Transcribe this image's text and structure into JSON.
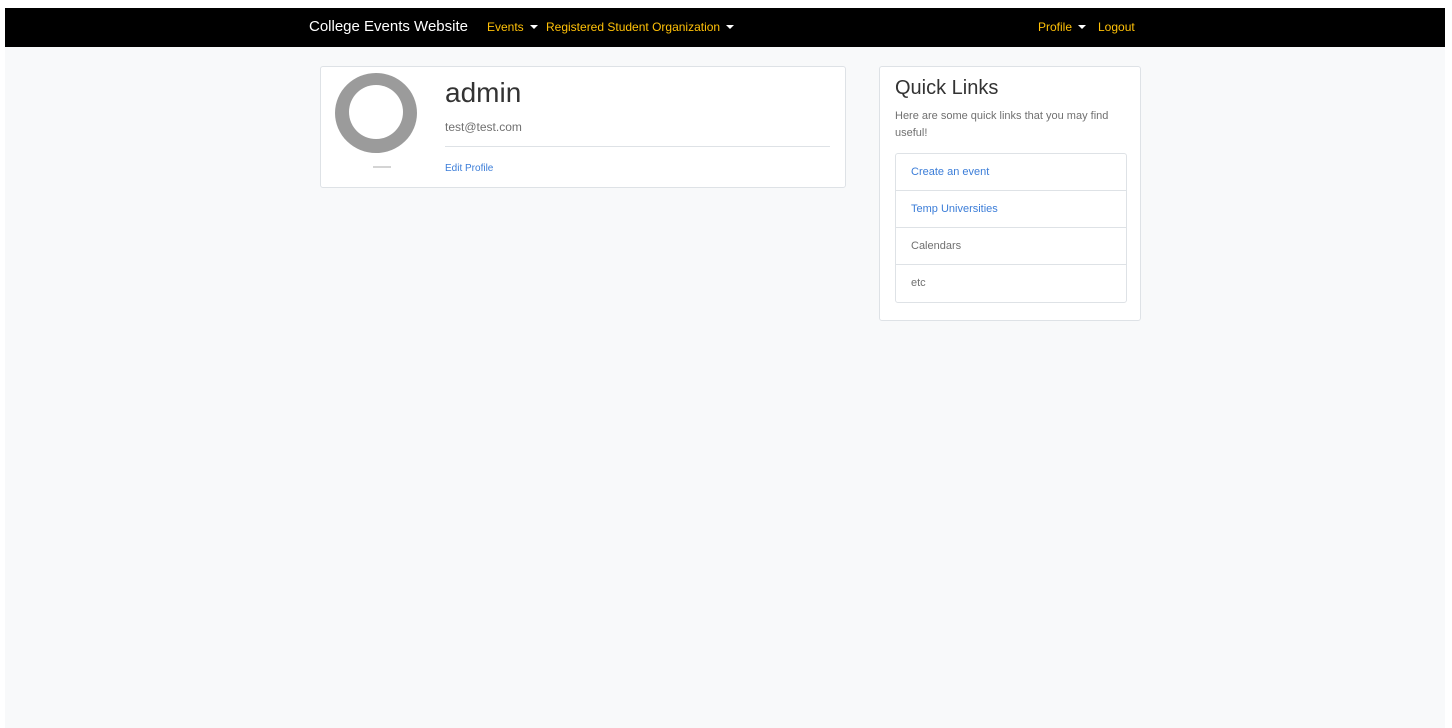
{
  "navbar": {
    "brand": "College Events Website",
    "events_label": "Events",
    "rso_label": "Registered Student Organization",
    "profile_label": "Profile",
    "logout_label": "Logout",
    "link_color": "#ffc107",
    "background_color": "#000000"
  },
  "profile": {
    "avatar_icon": "user-silhouette-icon",
    "username": "admin",
    "email": "test@test.com",
    "edit_link": "Edit Profile"
  },
  "quick_links": {
    "title": "Quick Links",
    "description": "Here are some quick links that you may find useful!",
    "items": [
      {
        "label": "Create an event",
        "is_link": true
      },
      {
        "label": "Temp Universities",
        "is_link": true
      },
      {
        "label": "Calendars",
        "is_link": false
      },
      {
        "label": "etc",
        "is_link": false
      }
    ]
  },
  "colors": {
    "accent_link": "#3b7dd8",
    "page_background": "#f8f9fa"
  }
}
